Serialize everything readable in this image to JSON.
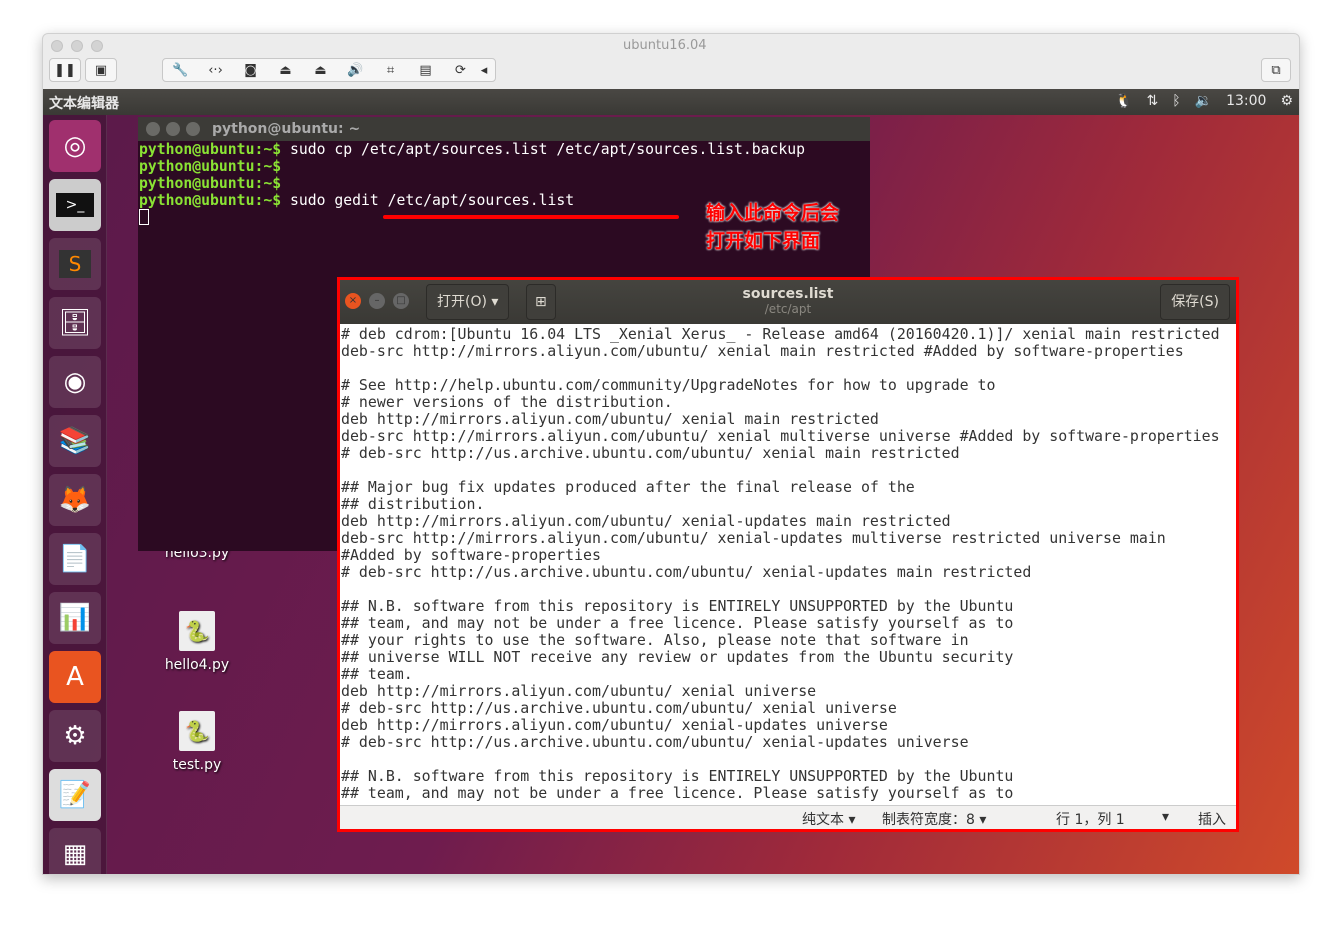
{
  "vm": {
    "title": "ubuntu16.04",
    "toolbar_icons": [
      "wrench-icon",
      "network-icon",
      "disk-icon",
      "cd-icon",
      "cd2-icon",
      "speaker-icon",
      "usb-icon",
      "floppy-icon",
      "refresh-icon",
      "collapse-icon"
    ]
  },
  "panel": {
    "app_name": "文本编辑器",
    "time": "13:00"
  },
  "launcher": [
    "ubuntu-dash",
    "terminal",
    "sublime-text",
    "files",
    "chrome",
    "books",
    "firefox",
    "writer",
    "calc",
    "software-center",
    "system-settings",
    "text-editor",
    "workspaces"
  ],
  "desktop": {
    "files": [
      "hello3.py",
      "hello4.py",
      "test.py"
    ]
  },
  "terminal": {
    "title": "python@ubuntu: ~",
    "prompt": "python@ubuntu:~$",
    "lines": [
      " sudo cp /etc/apt/sources.list /etc/apt/sources.list.backup",
      "",
      " ",
      " sudo gedit /etc/apt/sources.list"
    ]
  },
  "annotation": {
    "line1": "输入此命令后会",
    "line2": "打开如下界面",
    "color": "#ff0000"
  },
  "gedit": {
    "open_label": "打开(O)",
    "save_label": "保存(S)",
    "title": "sources.list",
    "path": "/etc/apt",
    "content": "# deb cdrom:[Ubuntu 16.04 LTS _Xenial Xerus_ - Release amd64 (20160420.1)]/ xenial main restricted\ndeb-src http://mirrors.aliyun.com/ubuntu/ xenial main restricted #Added by software-properties\n\n# See http://help.ubuntu.com/community/UpgradeNotes for how to upgrade to\n# newer versions of the distribution.\ndeb http://mirrors.aliyun.com/ubuntu/ xenial main restricted\ndeb-src http://mirrors.aliyun.com/ubuntu/ xenial multiverse universe #Added by software-properties\n# deb-src http://us.archive.ubuntu.com/ubuntu/ xenial main restricted\n\n## Major bug fix updates produced after the final release of the\n## distribution.\ndeb http://mirrors.aliyun.com/ubuntu/ xenial-updates main restricted\ndeb-src http://mirrors.aliyun.com/ubuntu/ xenial-updates multiverse restricted universe main\n#Added by software-properties\n# deb-src http://us.archive.ubuntu.com/ubuntu/ xenial-updates main restricted\n\n## N.B. software from this repository is ENTIRELY UNSUPPORTED by the Ubuntu\n## team, and may not be under a free licence. Please satisfy yourself as to\n## your rights to use the software. Also, please note that software in\n## universe WILL NOT receive any review or updates from the Ubuntu security\n## team.\ndeb http://mirrors.aliyun.com/ubuntu/ xenial universe\n# deb-src http://us.archive.ubuntu.com/ubuntu/ xenial universe\ndeb http://mirrors.aliyun.com/ubuntu/ xenial-updates universe\n# deb-src http://us.archive.ubuntu.com/ubuntu/ xenial-updates universe\n\n## N.B. software from this repository is ENTIRELY UNSUPPORTED by the Ubuntu\n## team, and may not be under a free licence. Please satisfy yourself as to",
    "status": {
      "lang": "纯文本 ▾",
      "tab": "制表符宽度：8 ▾",
      "pos": "行 1，列 1",
      "arrow": "▾",
      "mode": "插入"
    }
  }
}
